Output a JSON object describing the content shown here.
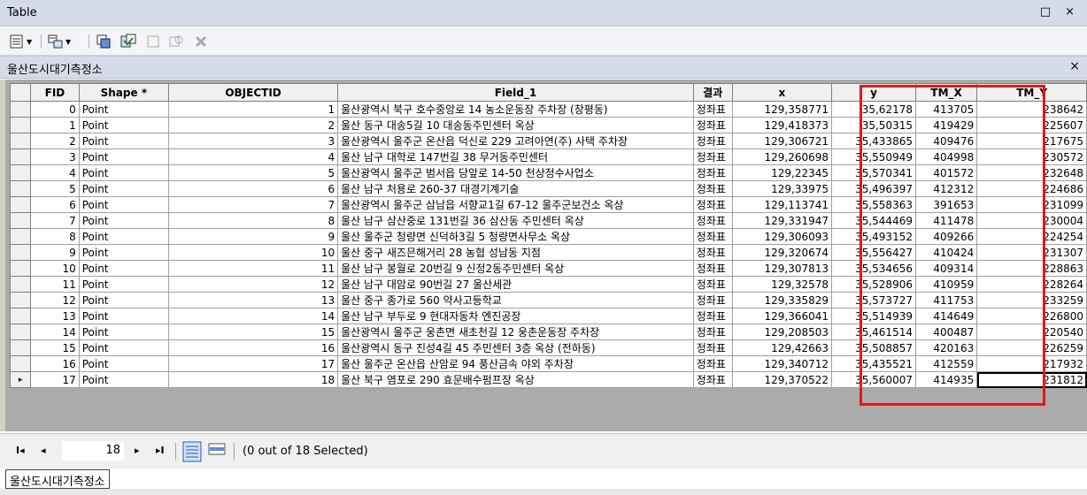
{
  "window": {
    "title": "Table",
    "controls": "□ ×"
  },
  "toolbar": {
    "icons": [
      "table-options-icon",
      "related-tables-icon",
      "select-by-attributes-icon",
      "switch-selection-icon",
      "clear-selection-icon",
      "zoom-to-selected-icon",
      "delete-selected-icon"
    ]
  },
  "table_tab": {
    "name": "울산도시대기측정소",
    "close": "×"
  },
  "columns": [
    "FID",
    "Shape *",
    "OBJECTID",
    "Field_1",
    "결과",
    "x",
    "y",
    "TM_X",
    "TM_Y"
  ],
  "rows": [
    [
      "0",
      "Point",
      "1",
      "울산광역시 북구 호수중앙로 14 농소운동장 주차장 (창평동)",
      "정좌표",
      "129,358771",
      "35,62178",
      "413705",
      "238642"
    ],
    [
      "1",
      "Point",
      "2",
      "울산 동구 대송5길 10 대송동주민센터 옥상",
      "정좌표",
      "129,418373",
      "35,50315",
      "419429",
      "225607"
    ],
    [
      "2",
      "Point",
      "3",
      "울산광역시 울주군 온산읍 덕신로 229 고려아연(주) 사택 주차장",
      "정좌표",
      "129,306721",
      "35,433865",
      "409476",
      "217675"
    ],
    [
      "3",
      "Point",
      "4",
      "울산 남구 대학로 147번길 38 무거동주민센터",
      "정좌표",
      "129,260698",
      "35,550949",
      "404998",
      "230572"
    ],
    [
      "4",
      "Point",
      "5",
      "울산광역시 울주군 범서읍 당앞로 14-50 천상정수사업소",
      "정좌표",
      "129,22345",
      "35,570341",
      "401572",
      "232648"
    ],
    [
      "5",
      "Point",
      "6",
      "울산 남구 처용로 260-37 대경기계기술",
      "정좌표",
      "129,33975",
      "35,496397",
      "412312",
      "224686"
    ],
    [
      "6",
      "Point",
      "7",
      "울산광역시 울주군 삼남읍 서향교1길 67-12 울주군보건소 옥상",
      "정좌표",
      "129,113741",
      "35,558363",
      "391653",
      "231099"
    ],
    [
      "7",
      "Point",
      "8",
      "울산 남구 삼산중로 131번길 36 삼산동 주민센터 옥상",
      "정좌표",
      "129,331947",
      "35,544469",
      "411478",
      "230004"
    ],
    [
      "8",
      "Point",
      "9",
      "울산 울주군 청량면 신덕하3길 5 청량면사무소 옥상",
      "정좌표",
      "129,306093",
      "35,493152",
      "409266",
      "224254"
    ],
    [
      "9",
      "Point",
      "10",
      "울산 중구 새즈믄해거리 28 농협 성남동 지점",
      "정좌표",
      "129,320674",
      "35,556427",
      "410424",
      "231307"
    ],
    [
      "10",
      "Point",
      "11",
      "울산 남구 봉월로 20번길 9 신정2동주민센터 옥상",
      "정좌표",
      "129,307813",
      "35,534656",
      "409314",
      "228863"
    ],
    [
      "11",
      "Point",
      "12",
      "울산 남구 대암로 90번길 27 울산세관",
      "정좌표",
      "129,32578",
      "35,528906",
      "410959",
      "228264"
    ],
    [
      "12",
      "Point",
      "13",
      "울산 중구 종가로 560 약사고등학교",
      "정좌표",
      "129,335829",
      "35,573727",
      "411753",
      "233259"
    ],
    [
      "13",
      "Point",
      "14",
      "울산 남구 부두로 9 현대자동차 엔진공장",
      "정좌표",
      "129,366041",
      "35,514939",
      "414649",
      "226800"
    ],
    [
      "14",
      "Point",
      "15",
      "울산광역시 울주군 웅촌면 새초천길 12 웅촌운동장 주차장",
      "정좌표",
      "129,208503",
      "35,461514",
      "400487",
      "220540"
    ],
    [
      "15",
      "Point",
      "16",
      "울산광역시 동구 진성4길 45 주민센터 3층 옥상 (전하동)",
      "정좌표",
      "129,42663",
      "35,508857",
      "420163",
      "226259"
    ],
    [
      "16",
      "Point",
      "17",
      "울산 울주군 온산읍 산암로 94 풍산금속 야외 주차장",
      "정좌표",
      "129,340712",
      "35,435521",
      "412559",
      "217932"
    ],
    [
      "17",
      "Point",
      "18",
      "울산 북구 염포로 290 효문배수펌프장 옥상",
      "정좌표",
      "129,370522",
      "35,560007",
      "414935",
      "231812"
    ]
  ],
  "current_row_marker": "▸",
  "nav": {
    "first": "I◂",
    "prev": "◂",
    "record": "18",
    "next": "▸",
    "last": "▸I",
    "status": "(0 out of 18 Selected)"
  },
  "bottom_tab": "울산도시대기측정소",
  "accent": {
    "highlight": "#e0191b",
    "titlebar": "#d6dbe9"
  }
}
